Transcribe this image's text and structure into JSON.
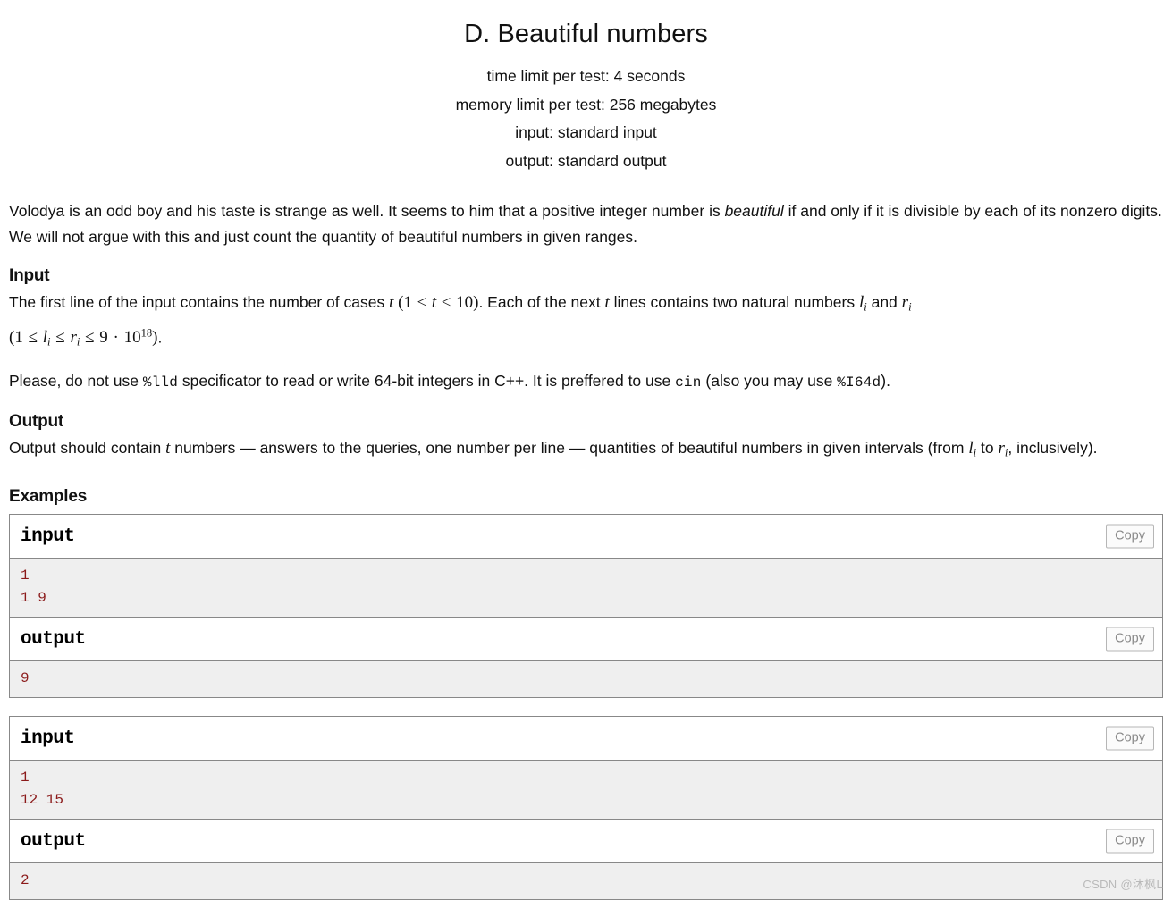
{
  "problem": {
    "title": "D. Beautiful numbers",
    "limits": [
      "time limit per test: 4 seconds",
      "memory limit per test: 256 megabytes",
      "input: standard input",
      "output: standard output"
    ]
  },
  "legend": {
    "para1_a": "Volodya is an odd boy and his taste is strange as well. It seems to him that a positive integer number is ",
    "para1_em": "beautiful",
    "para1_b": " if and only if it is divisible by each of its nonzero digits. We will not argue with this and just count the quantity of beautiful numbers in given ranges."
  },
  "input_section": {
    "heading": "Input",
    "line1_a": "The first line of the input contains the number of cases ",
    "line1_var_t": "t",
    "line1_math1": "(1 ≤ t ≤ 10)",
    "line1_b": ". Each of the next ",
    "line1_var_t2": "t",
    "line1_c": " lines contains two natural numbers ",
    "line1_var_l": "l",
    "line1_var_l_sub": "i",
    "line1_d": " and ",
    "line1_var_r": "r",
    "line1_var_r_sub": "i",
    "line2_math": "(1 ≤ l_i ≤ r_i ≤ 9 · 10^18).",
    "note_a": "Please, do not use ",
    "note_code1": "%lld",
    "note_b": " specificator to read or write 64-bit integers in C++. It is preffered to use ",
    "note_code2": "cin",
    "note_c": " (also you may use ",
    "note_code3": "%I64d",
    "note_d": ")."
  },
  "output_section": {
    "heading": "Output",
    "line_a": "Output should contain ",
    "var_t": "t",
    "line_b": " numbers — answers to the queries, one number per line — quantities of beautiful numbers in given intervals (from ",
    "var_l": "l",
    "var_l_sub": "i",
    "line_c": " to ",
    "var_r": "r",
    "var_r_sub": "i",
    "line_d": ", inclusively)."
  },
  "examples": {
    "heading": "Examples",
    "copy_label": "Copy",
    "input_label": "input",
    "output_label": "output",
    "tests": [
      {
        "input": "1\n1 9",
        "output": "9"
      },
      {
        "input": "1\n12 15",
        "output": "2"
      }
    ]
  },
  "watermark": {
    "text": "CSDN @沐枫L"
  },
  "colors": {
    "sample_text": "#8b1a1a",
    "sample_bg": "#efefef",
    "border": "#888888",
    "copy_text": "#8a8a8a",
    "watermark": "#b9b9b9"
  }
}
